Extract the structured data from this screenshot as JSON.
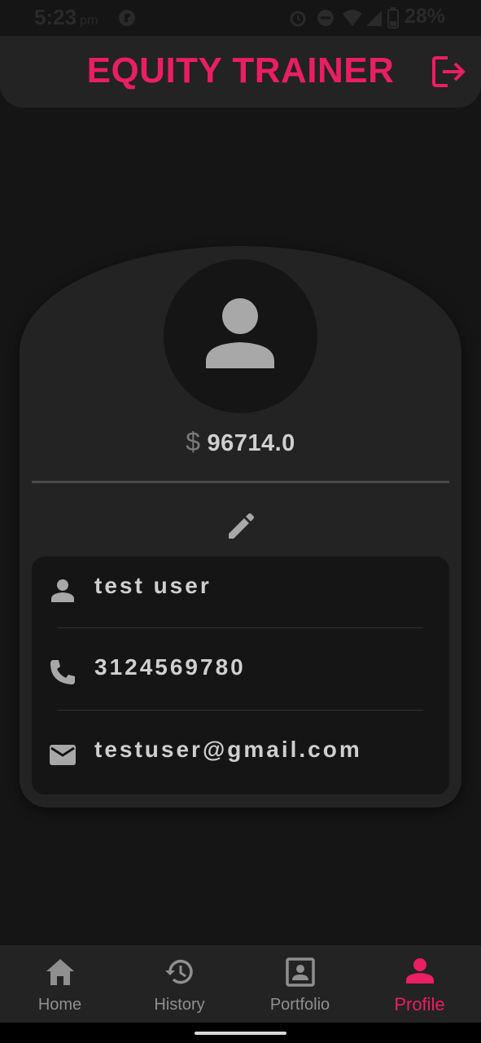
{
  "status_bar": {
    "time": "5:23",
    "ampm": "pm",
    "battery": "28%"
  },
  "app_bar": {
    "title": "EQUITY TRAINER"
  },
  "profile": {
    "currency_symbol": "$",
    "balance": "96714.0",
    "name": "test user",
    "phone": "3124569780",
    "email": "testuser@gmail.com"
  },
  "bottom_nav": {
    "items": [
      {
        "label": "Home",
        "icon": "home-icon"
      },
      {
        "label": "History",
        "icon": "history-icon"
      },
      {
        "label": "Portfolio",
        "icon": "portfolio-icon"
      },
      {
        "label": "Profile",
        "icon": "person-icon"
      }
    ],
    "active": "Profile"
  },
  "colors": {
    "accent": "#e91e63",
    "background": "#151515",
    "surface": "#232323",
    "text": "#cfcfcf",
    "icon": "#a8a8a8"
  }
}
